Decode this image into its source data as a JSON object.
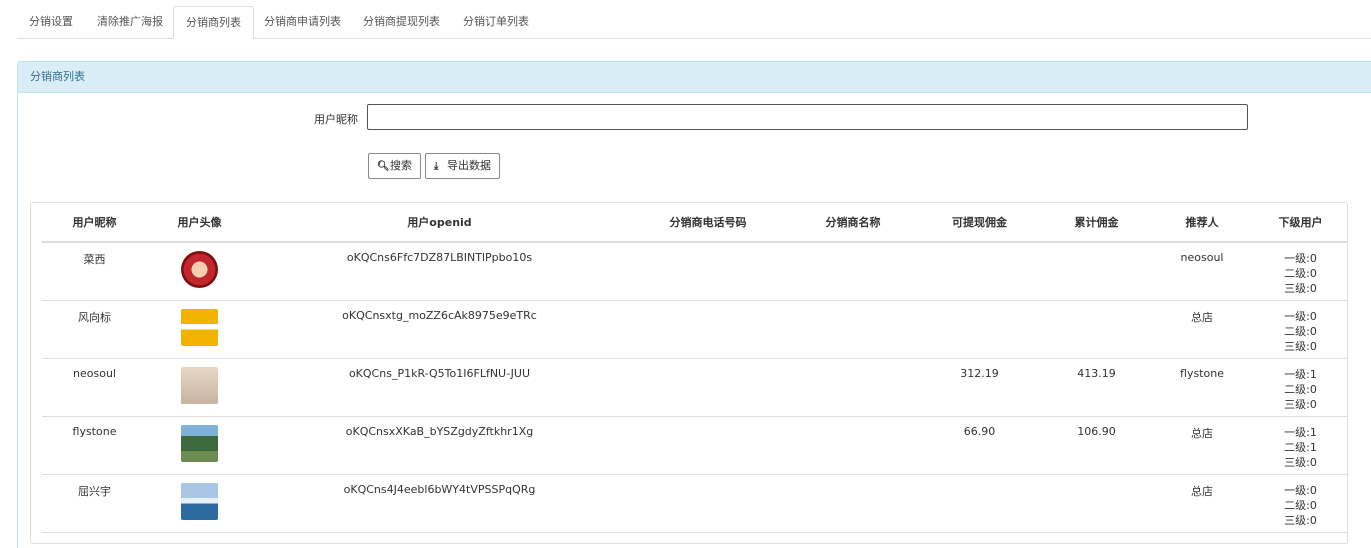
{
  "tabs": [
    "分销设置",
    "清除推广海报",
    "分销商列表",
    "分销商申请列表",
    "分销商提现列表",
    "分销订单列表"
  ],
  "panel": {
    "title": "分销商列表"
  },
  "form": {
    "label": "用户昵称",
    "placeholder": "",
    "search_label": "搜索",
    "export_label": "导出数据"
  },
  "icons": {
    "search": "search-icon",
    "export": "download-icon"
  },
  "table": {
    "headers": [
      "用户昵称",
      "用户头像",
      "用户openid",
      "分销商电话号码",
      "分销商名称",
      "可提现佣金",
      "累计佣金",
      "推荐人",
      "下级用户"
    ],
    "rows": [
      {
        "nickname": "菜西",
        "openid": "oKQCns6Ffc7DZ87LBINTlPpbo10s",
        "phone": "",
        "name": "",
        "withdrawable": "",
        "total": "",
        "referrer": "neosoul",
        "levels": [
          "一级:0",
          "二级:0",
          "三级:0"
        ]
      },
      {
        "nickname": "风向标",
        "openid": "oKQCnsxtg_moZZ6cAk8975e9eTRc",
        "phone": "",
        "name": "",
        "withdrawable": "",
        "total": "",
        "referrer": "总店",
        "levels": [
          "一级:0",
          "二级:0",
          "三级:0"
        ]
      },
      {
        "nickname": "neosoul",
        "openid": "oKQCns_P1kR-Q5To1I6FLfNU-JUU",
        "phone": "",
        "name": "",
        "withdrawable": "312.19",
        "total": "413.19",
        "referrer": "flystone",
        "levels": [
          "一级:1",
          "二级:0",
          "三级:0"
        ]
      },
      {
        "nickname": "flystone",
        "openid": "oKQCnsxXKaB_bYSZgdyZftkhr1Xg",
        "phone": "",
        "name": "",
        "withdrawable": "66.90",
        "total": "106.90",
        "referrer": "总店",
        "levels": [
          "一级:1",
          "二级:1",
          "三级:0"
        ]
      },
      {
        "nickname": "屈兴宇",
        "openid": "oKQCns4J4eebl6bWY4tVPSSPqQRg",
        "phone": "",
        "name": "",
        "withdrawable": "",
        "total": "",
        "referrer": "总店",
        "levels": [
          "一级:0",
          "二级:0",
          "三级:0"
        ]
      }
    ]
  }
}
